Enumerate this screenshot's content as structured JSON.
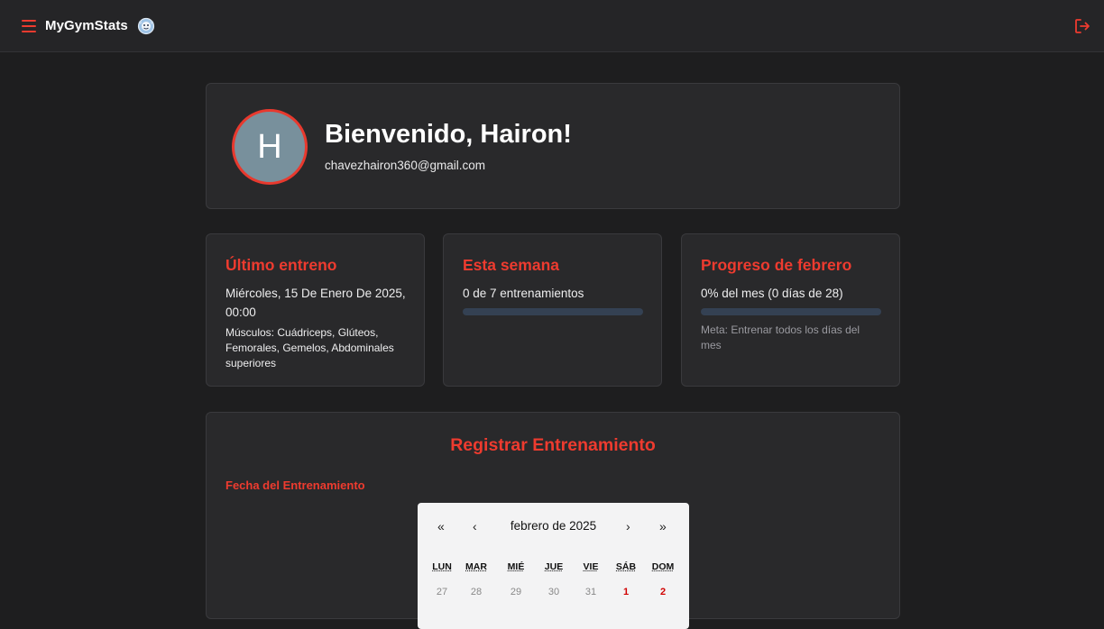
{
  "app": {
    "name": "MyGymStats",
    "logo_icon": "mascot-logo-icon",
    "menu_icon": "hamburger-menu-icon",
    "logout_icon": "logout-icon",
    "accent_color": "#ee3b2f"
  },
  "profile": {
    "avatar_letter": "H",
    "greeting": "Bienvenido, Hairon!",
    "email": "chavezhairon360@gmail.com"
  },
  "stats": {
    "last_workout": {
      "title": "Último entreno",
      "date": "Miércoles, 15 De Enero De 2025, 00:00",
      "muscles": "Músculos: Cuádriceps, Glúteos, Femorales, Gemelos, Abdominales superiores"
    },
    "this_week": {
      "title": "Esta semana",
      "value": "0 de 7 entrenamientos",
      "progress_fraction": 0
    },
    "month_progress": {
      "title": "Progreso de febrero",
      "value": "0% del mes (0 días de 28)",
      "progress_fraction": 0,
      "goal": "Meta: Entrenar todos los días del mes"
    }
  },
  "register": {
    "title": "Registrar Entrenamiento",
    "date_label": "Fecha del Entrenamiento",
    "calendar": {
      "prev_year": "«",
      "prev_month": "‹",
      "month_label": "febrero de 2025",
      "next_month": "›",
      "next_year": "»",
      "weekdays": [
        "LUN",
        "MAR",
        "MIÉ",
        "JUE",
        "VIE",
        "SÁB",
        "DOM"
      ],
      "first_row": [
        {
          "day": "27",
          "state": "muted"
        },
        {
          "day": "28",
          "state": "muted"
        },
        {
          "day": "29",
          "state": "muted"
        },
        {
          "day": "30",
          "state": "muted"
        },
        {
          "day": "31",
          "state": "muted"
        },
        {
          "day": "1",
          "state": "weekend"
        },
        {
          "day": "2",
          "state": "weekend"
        }
      ]
    }
  }
}
